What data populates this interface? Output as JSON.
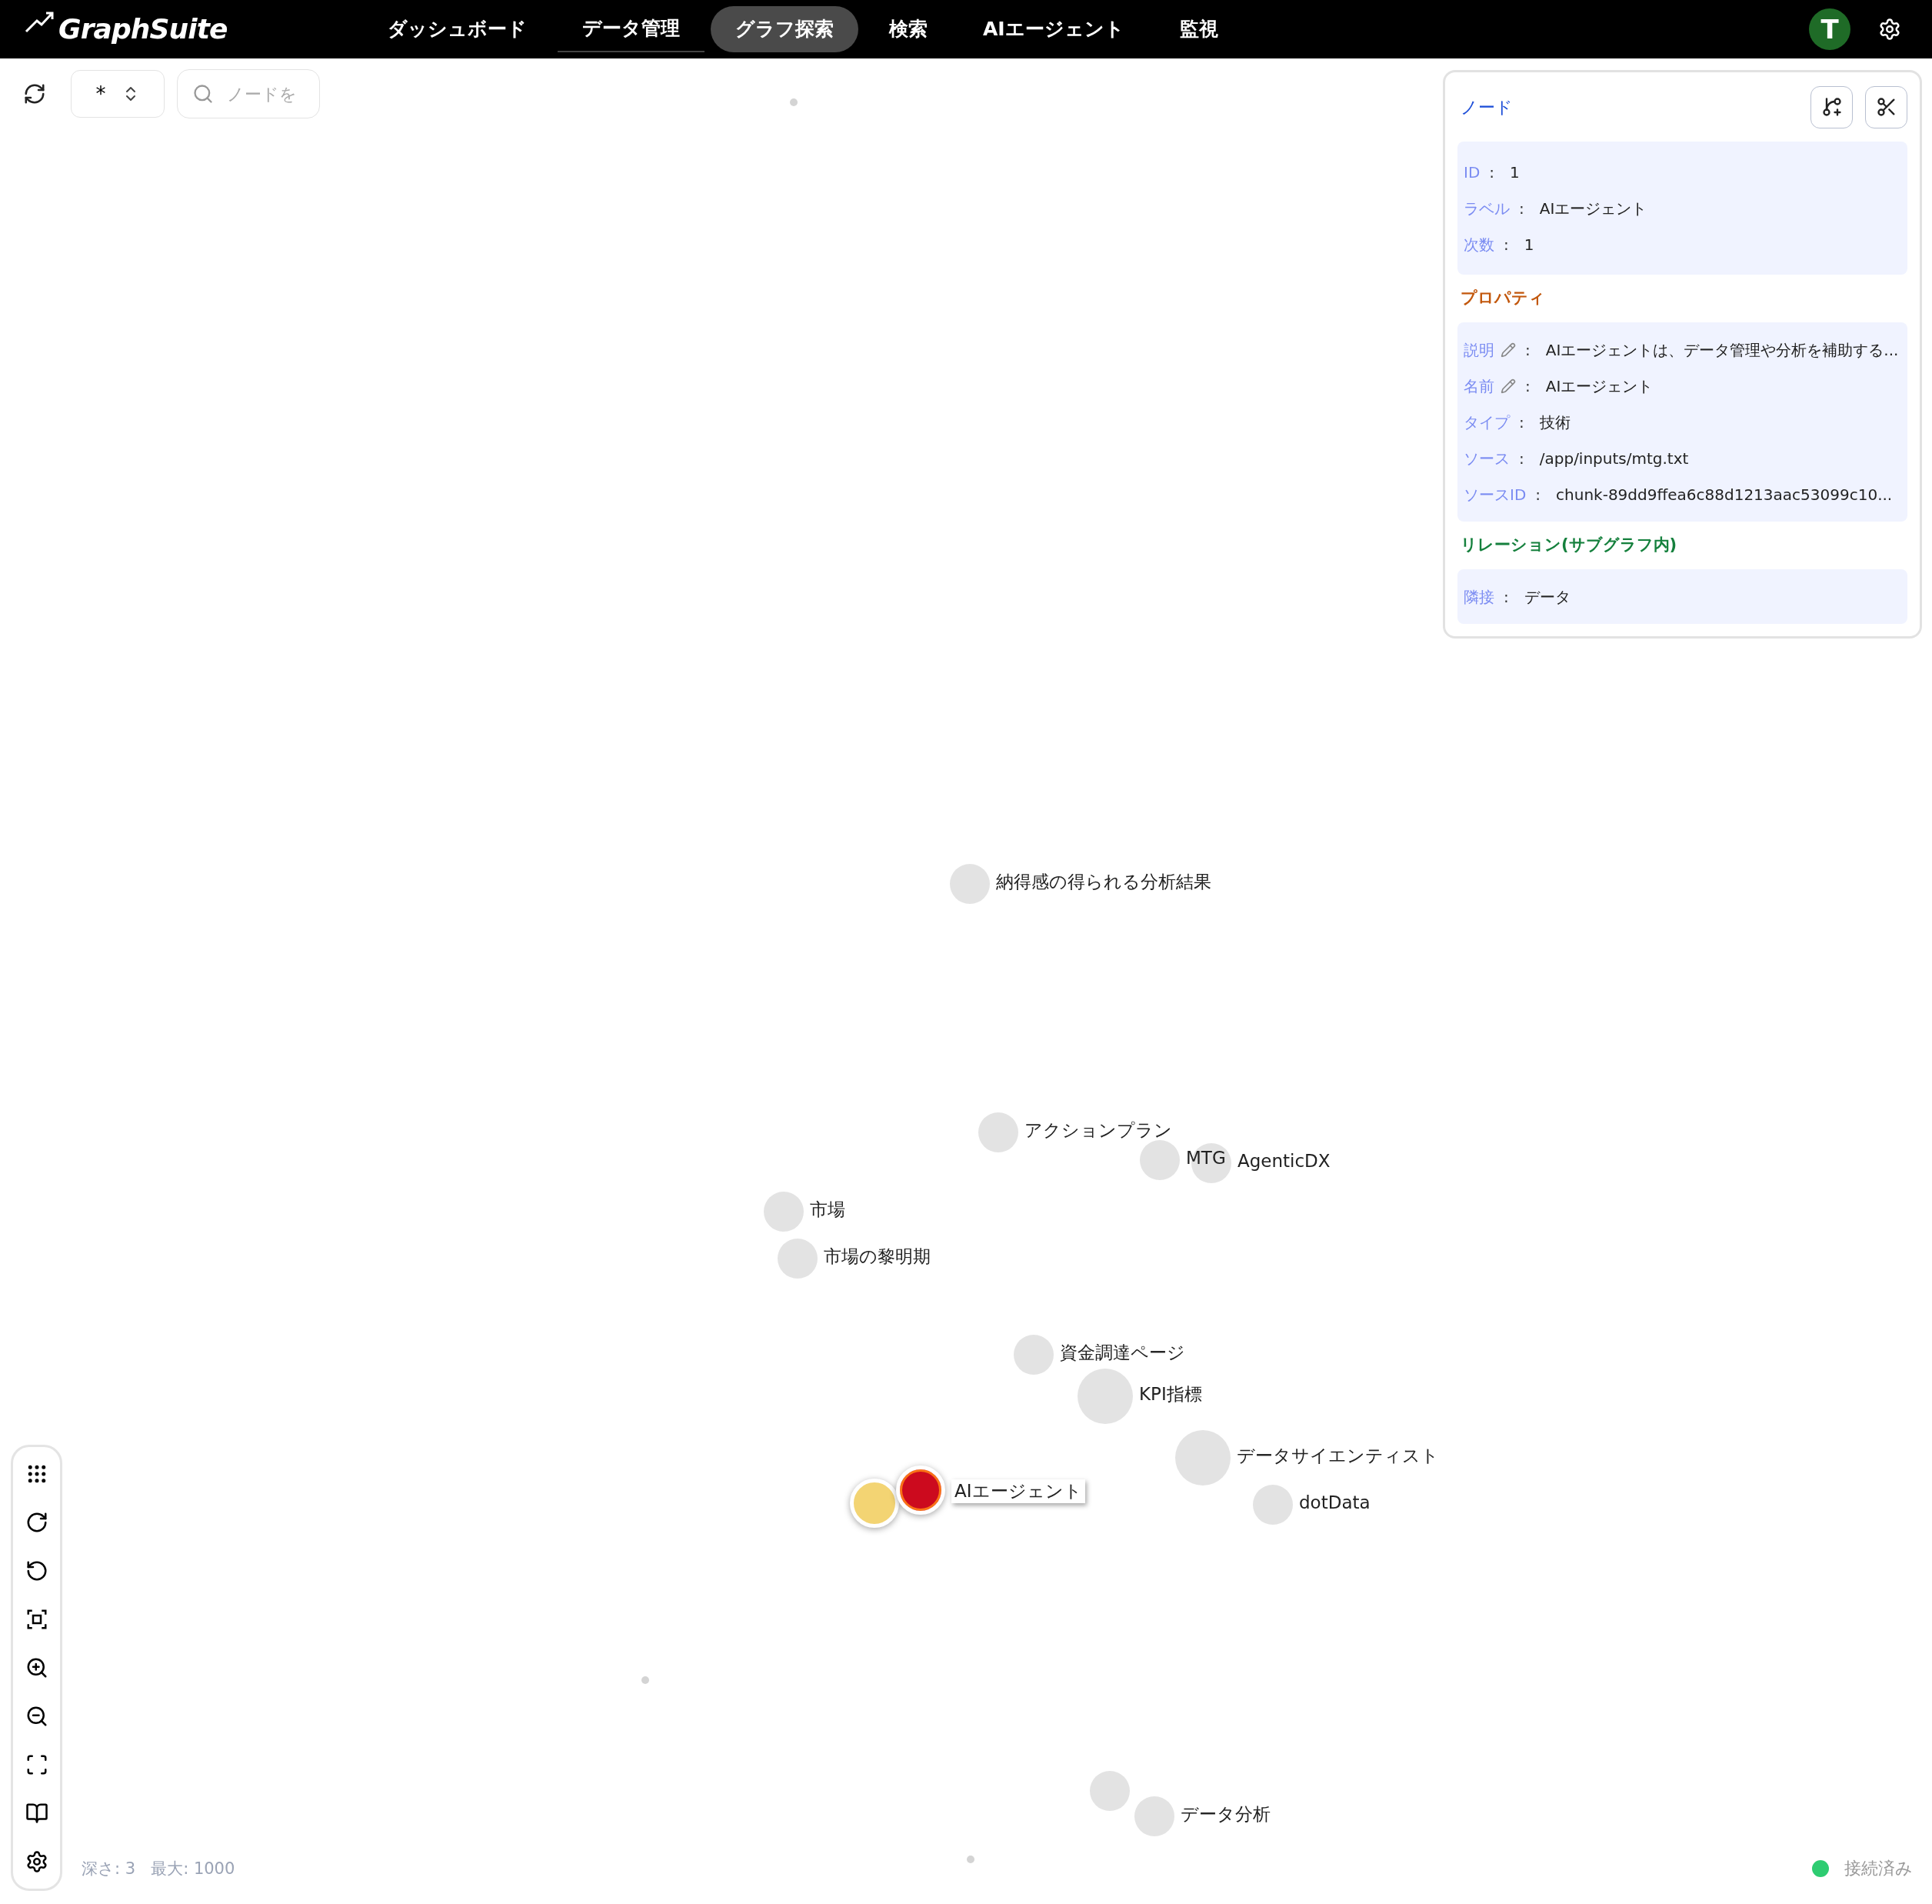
{
  "header": {
    "logo": "GraphSuite",
    "nav": [
      {
        "label": "ダッシュボード",
        "selected": false,
        "underlined": false
      },
      {
        "label": "データ管理",
        "selected": false,
        "underlined": true
      },
      {
        "label": "グラフ探索",
        "selected": true,
        "underlined": false
      },
      {
        "label": "検索",
        "selected": false,
        "underlined": false
      },
      {
        "label": "AIエージェント",
        "selected": false,
        "underlined": false
      },
      {
        "label": "監視",
        "selected": false,
        "underlined": false
      }
    ],
    "avatar": "T"
  },
  "toolbar": {
    "depth_select": "*",
    "search": {
      "placeholder": "ノードを"
    }
  },
  "panel": {
    "title": "ノード",
    "basic": [
      {
        "key": "ID",
        "sep": ":",
        "value": "1",
        "editable": false
      },
      {
        "key": "ラベル",
        "sep": ":",
        "value": "AIエージェント",
        "editable": false
      },
      {
        "key": "次数",
        "sep": ":",
        "value": "1",
        "editable": false
      }
    ],
    "properties_title": "プロパティ",
    "properties": [
      {
        "key": "説明",
        "sep": ":",
        "value": "AIエージェントは、データ管理や分析を補助する...",
        "editable": true
      },
      {
        "key": "名前",
        "sep": ":",
        "value": "AIエージェント",
        "editable": true
      },
      {
        "key": "タイプ",
        "sep": ":",
        "value": "技術",
        "editable": false
      },
      {
        "key": "ソース",
        "sep": ":",
        "value": "/app/inputs/mtg.txt",
        "editable": false
      },
      {
        "key": "ソースID",
        "sep": ":",
        "value": "chunk-89dd9ffea6c88d1213aac53099c10...",
        "editable": false
      }
    ],
    "relations_title": "リレーション(サブグラフ内)",
    "relations": [
      {
        "key": "隣接",
        "sep": ":",
        "value": "データ",
        "editable": false
      }
    ]
  },
  "graph": {
    "nodes": [
      {
        "kind": "dot"
      },
      {
        "kind": "node",
        "label": "納得感の得られる分析結果",
        "color": "#e3e3e3",
        "selected": false
      },
      {
        "kind": "node",
        "label": "アクションプラン",
        "color": "#e3e3e3",
        "selected": false
      },
      {
        "kind": "node",
        "label": "MTG",
        "color": "#e3e3e3",
        "selected": false
      },
      {
        "kind": "node",
        "label": "AgenticDX",
        "color": "#e3e3e3",
        "selected": false
      },
      {
        "kind": "node",
        "label": "市場",
        "color": "#e3e3e3",
        "selected": false
      },
      {
        "kind": "node",
        "label": "市場の黎明期",
        "color": "#e3e3e3",
        "selected": false
      },
      {
        "kind": "node",
        "label": "資金調達ページ",
        "color": "#e3e3e3",
        "selected": false
      },
      {
        "kind": "node",
        "label": "KPI指標",
        "color": "#e3e3e3",
        "selected": false
      },
      {
        "kind": "node",
        "label": "データサイエンティスト",
        "color": "#e3e3e3",
        "selected": false
      },
      {
        "kind": "node",
        "label": "dotData",
        "color": "#e3e3e3",
        "selected": false
      },
      {
        "kind": "node",
        "color": "#f3d473",
        "selected": false
      },
      {
        "kind": "node",
        "label": "AIエージェント",
        "color": "#cc0a1e",
        "selected": true
      },
      {
        "kind": "dot"
      },
      {
        "kind": "node",
        "color": "#e3e3e3",
        "selected": false
      },
      {
        "kind": "node",
        "label": "データ分析",
        "color": "#e3e3e3",
        "selected": false
      },
      {
        "kind": "dot"
      }
    ]
  },
  "status": {
    "depth": "深さ: 3",
    "max": "最大: 1000",
    "connection": "接続済み",
    "connected": true
  }
}
